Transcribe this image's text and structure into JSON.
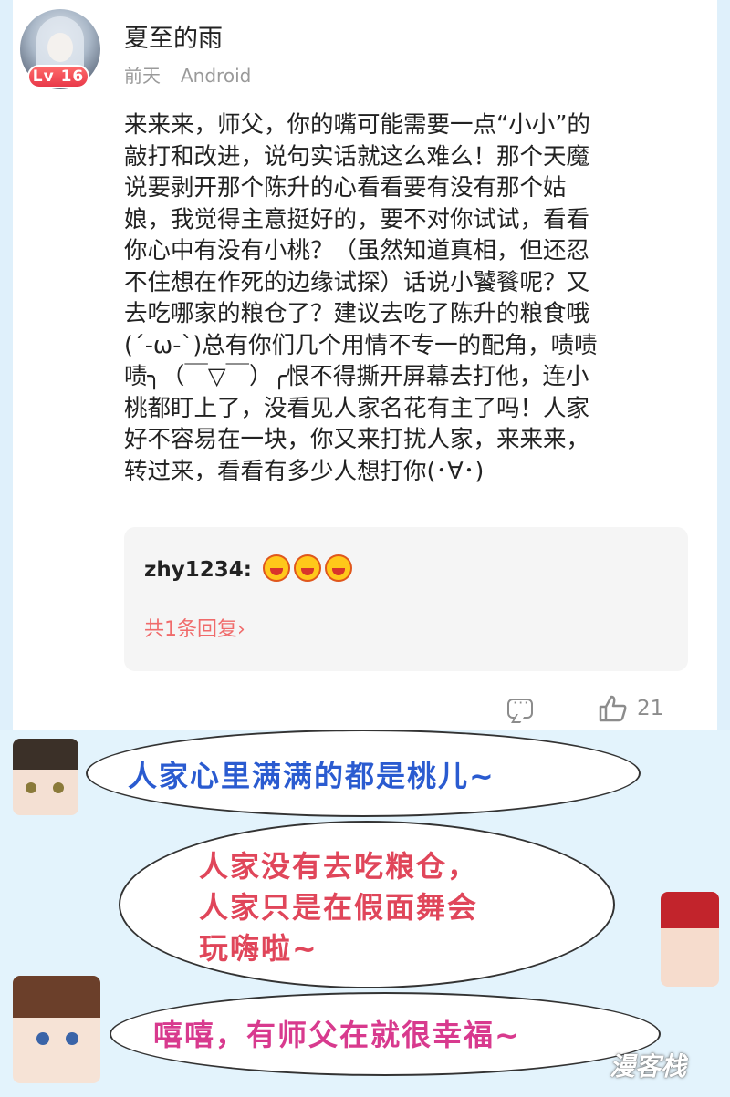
{
  "user": {
    "name": "夏至的雨",
    "level_badge": "Lv 16",
    "time": "前天",
    "device": "Android"
  },
  "comment_lines": [
    "来来来，师父，你的嘴可能需要一点“小小”的",
    "敲打和改进，说句实话就这么难么！那个天魔",
    "说要剥开那个陈升的心看看要有没有那个姑",
    "娘，我觉得主意挺好的，要不对你试试，看看",
    "你心中有没有小桃？（虽然知道真相，但还忍",
    "不住想在作死的边缘试探）话说小饕餮呢？又",
    "去吃哪家的粮仓了？建议去吃了陈升的粮食哦",
    "(´-ω-`)总有你们几个用情不专一的配角，啧啧",
    "啧╮（￣▽￣）╭恨不得撕开屏幕去打他，连小",
    "桃都盯上了，没看见人家名花有主了吗！人家",
    "好不容易在一块，你又来打扰人家，来来来，",
    "转过来，看看有多少人想打你(･∀･)"
  ],
  "reply": {
    "author": "zhy1234:",
    "emoji_icon": "laughing-face-icon",
    "more_label": "共1条回复",
    "more_chevron": "›"
  },
  "actions": {
    "comment_icon": "comment-icon",
    "like_icon": "thumbs-up-icon",
    "like_count": "21"
  },
  "bubbles": {
    "b1": "人家心里满满的都是桃儿~",
    "b2_lines": [
      "人家没有去吃粮仓，",
      "人家只是在假面舞会",
      "玩嗨啦~"
    ],
    "b3": "嘻嘻，有师父在就很幸福~"
  },
  "watermark": "漫客栈",
  "colors": {
    "background_side": "#dff0fb",
    "level_badge": "#e9394a",
    "reply_link": "#f06b6b",
    "bubble1_text": "#2a5bd0",
    "bubble2_text": "#e0465a",
    "bubble3_text": "#d83a8e"
  }
}
